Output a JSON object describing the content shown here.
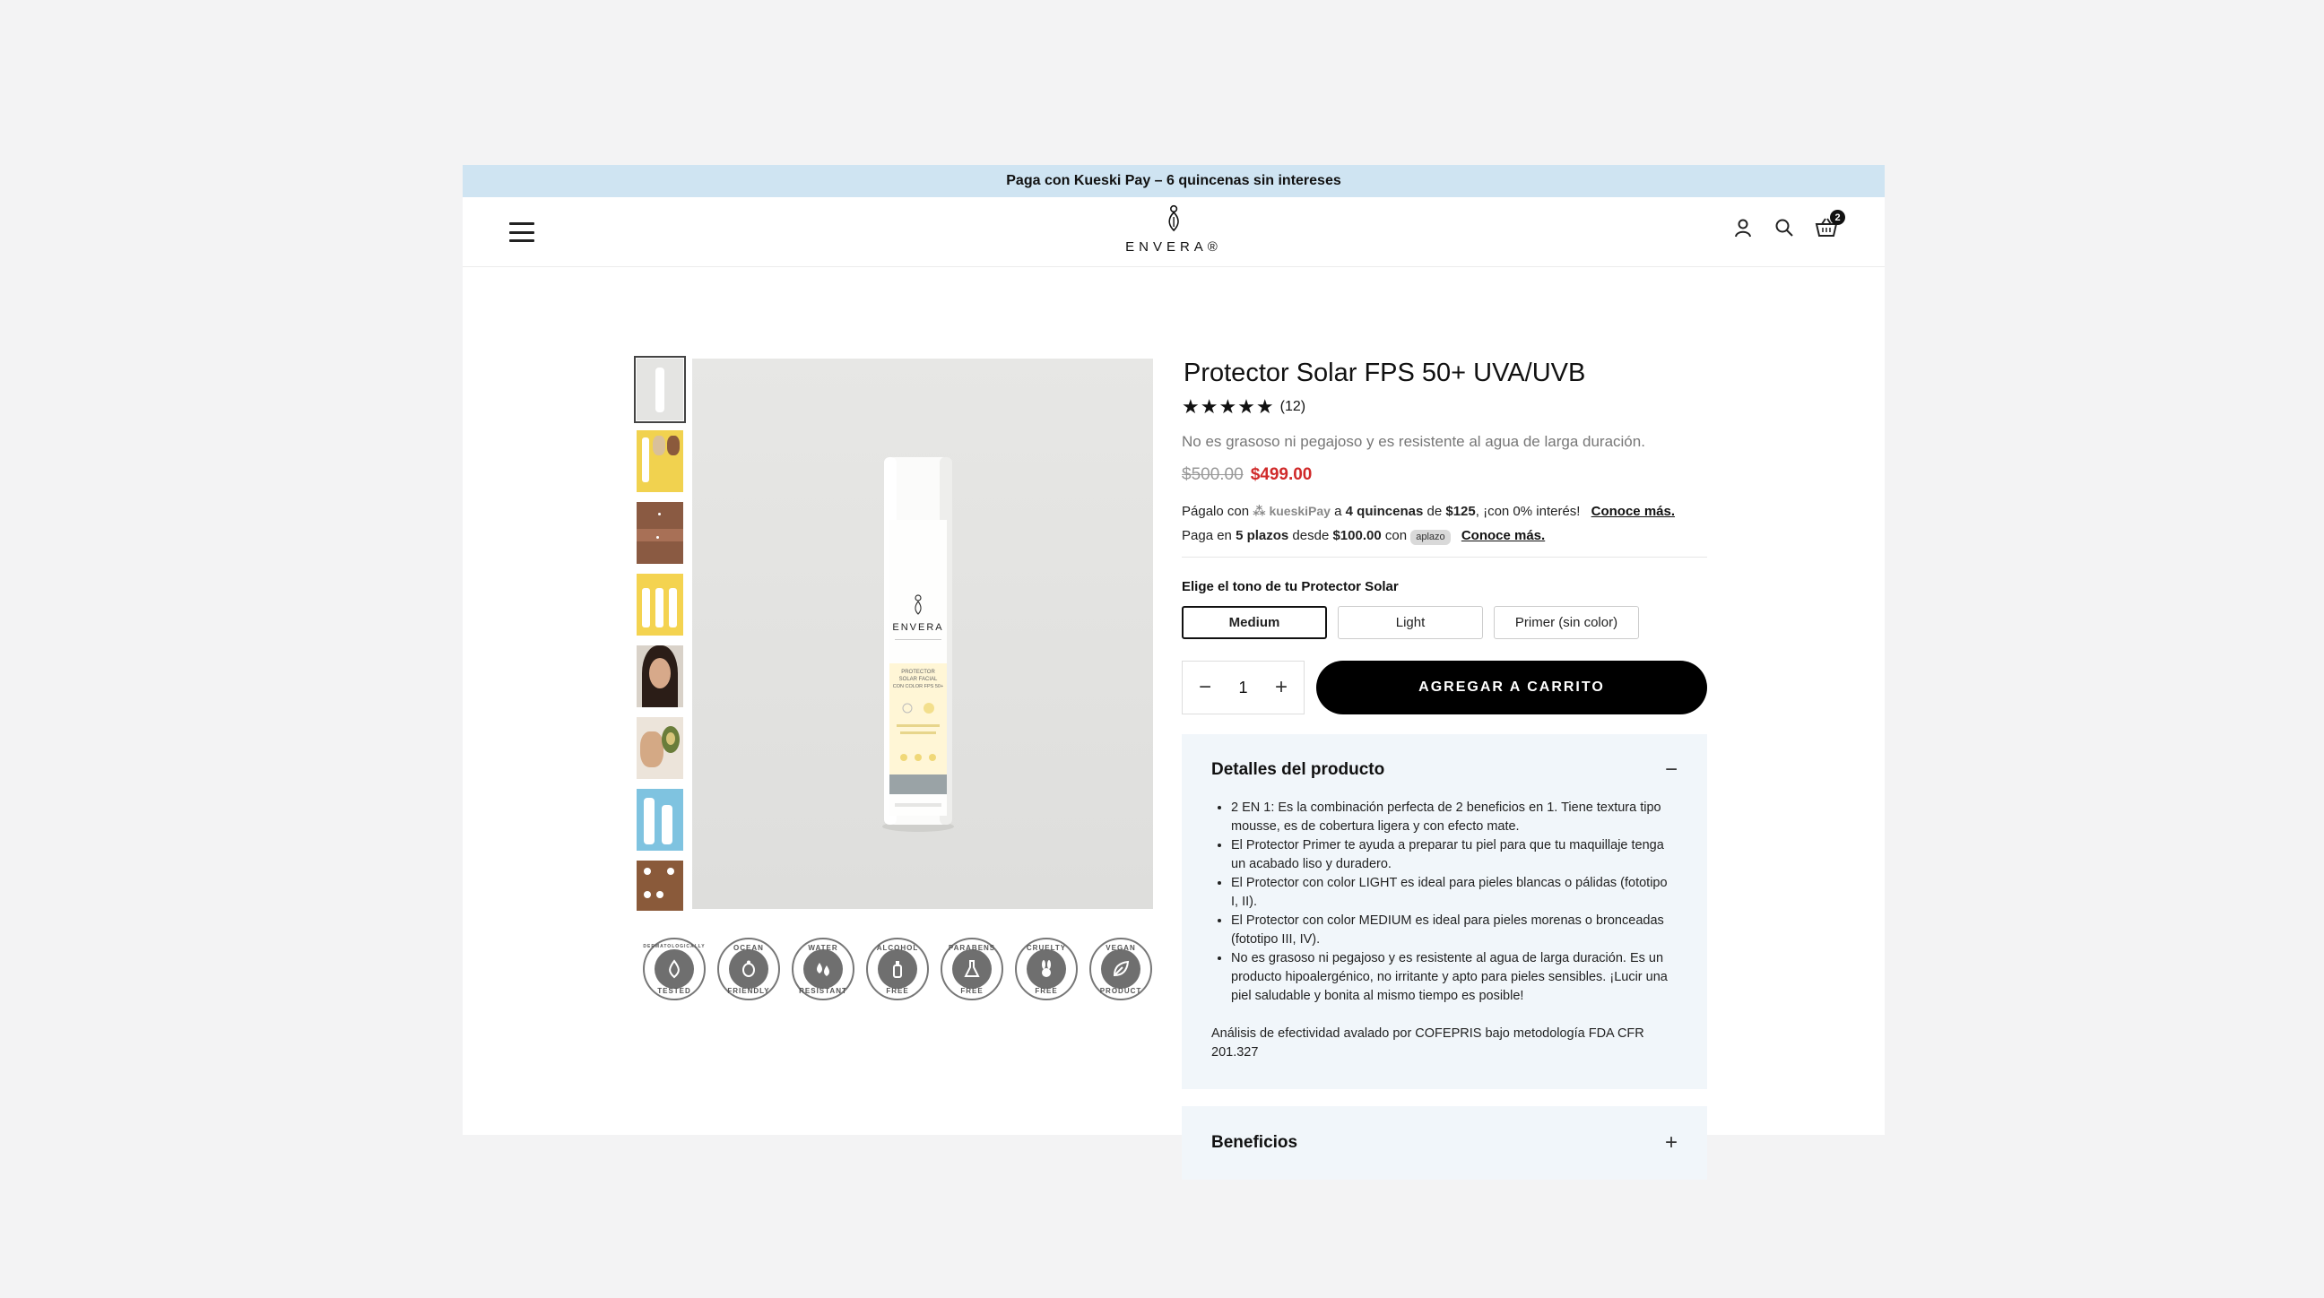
{
  "announcement": "Paga con Kueski Pay – 6 quincenas sin intereses",
  "header": {
    "logo_text": "ENVERA®",
    "cart_count": "2",
    "icons": [
      "menu-icon",
      "user-icon",
      "search-icon",
      "cart-icon"
    ]
  },
  "gallery": {
    "thumbnail_count": 8,
    "main_image": {
      "brand": "ENVERA",
      "label_lines": [
        "PROTECTOR",
        "SOLAR FACIAL",
        "CON COLOR FPS 50+"
      ]
    }
  },
  "badges": [
    {
      "top": "DERMATOLOGICALLY",
      "bottom": "TESTED",
      "icon": "drop-icon"
    },
    {
      "top": "OCEAN",
      "bottom": "FRIENDLY",
      "icon": "turtle-icon"
    },
    {
      "top": "WATER",
      "bottom": "RESISTANT",
      "icon": "water-drops-icon"
    },
    {
      "top": "ALCOHOL",
      "bottom": "FREE",
      "icon": "bottle-icon"
    },
    {
      "top": "PARABENS",
      "bottom": "FREE",
      "icon": "flask-icon"
    },
    {
      "top": "CRUELTY",
      "bottom": "FREE",
      "icon": "rabbit-icon"
    },
    {
      "top": "VEGAN",
      "bottom": "PRODUCT",
      "icon": "leaf-icon"
    }
  ],
  "product": {
    "title": "Protector Solar FPS 50+ UVA/UVB",
    "rating_stars": 5,
    "review_count": "(12)",
    "subtitle": "No es grasoso ni pegajoso y es resistente al agua de larga duración.",
    "old_price": "$500.00",
    "price": "$499.00"
  },
  "payments": {
    "kueski_prefix": "Págalo con",
    "kueski_brand": "kueskiPay",
    "kueski_a": "a",
    "kueski_installments": "4 quincenas",
    "kueski_de": "de",
    "kueski_amount": "$125",
    "kueski_suffix": ", ¡con 0% interés!",
    "kueski_link": "Conoce más.",
    "aplazo_prefix": "Paga en",
    "aplazo_installments": "5 plazos",
    "aplazo_desde": "desde",
    "aplazo_amount": "$100.00",
    "aplazo_con": "con",
    "aplazo_brand": "aplazo",
    "aplazo_link": "Conoce más."
  },
  "tone": {
    "label": "Elige el tono de tu Protector Solar",
    "options": [
      "Medium",
      "Light",
      "Primer (sin color)"
    ],
    "selected": "Medium"
  },
  "purchase": {
    "quantity": "1",
    "add_to_cart": "AGREGAR A CARRITO"
  },
  "details": {
    "title": "Detalles del producto",
    "items": [
      "2 EN 1: Es la combinación perfecta de 2 beneficios en 1. Tiene textura tipo mousse, es de cobertura ligera y con efecto mate.",
      "El Protector Primer te ayuda a preparar tu piel para que tu maquillaje tenga un acabado liso y duradero.",
      "El Protector con color LIGHT es ideal para pieles blancas o pálidas (fototipo I, II).",
      "El Protector con color MEDIUM es ideal para pieles morenas o bronceadas (fototipo III, IV).",
      "No es grasoso ni pegajoso y es resistente al agua de larga duración. Es un producto hipoalergénico, no irritante y apto para pieles sensibles.  ¡Lucir una piel saludable y bonita al mismo tiempo es posible!"
    ],
    "note": "Análisis de efectividad avalado por COFEPRIS bajo metodología FDA CFR 201.327"
  },
  "benefits": {
    "title": "Beneficios"
  }
}
